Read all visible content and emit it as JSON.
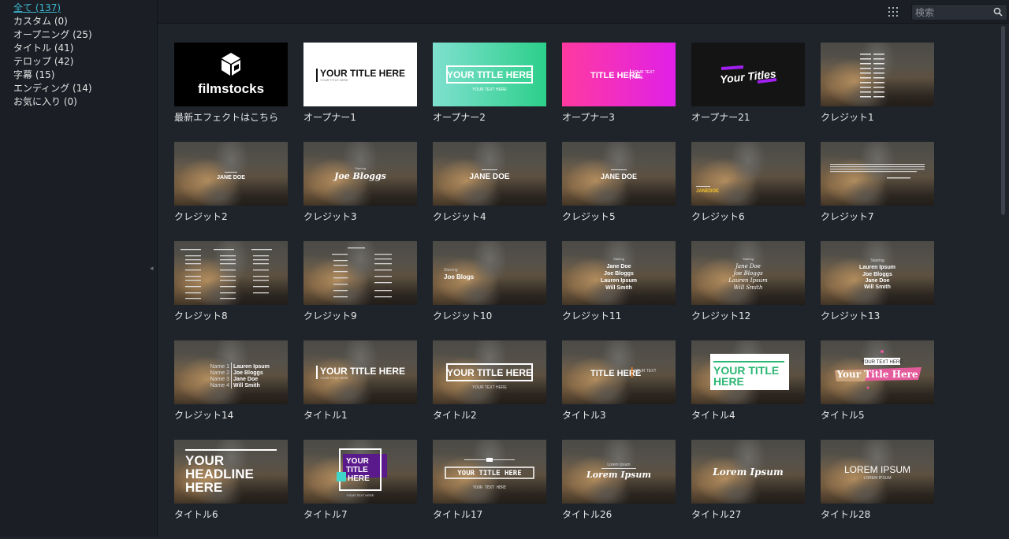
{
  "sidebar": {
    "categories": [
      {
        "label": "全て (137)"
      },
      {
        "label": "カスタム (0)"
      },
      {
        "label": "オープニング (25)"
      },
      {
        "label": "タイトル (41)"
      },
      {
        "label": "テロップ (42)"
      },
      {
        "label": "字幕 (15)"
      },
      {
        "label": "エンディング (14)"
      },
      {
        "label": "お気に入り (0)"
      }
    ],
    "collapse_glyph": "◂"
  },
  "toolbar": {
    "search_placeholder": "検索"
  },
  "colors": {
    "accent": "#3bb6cf",
    "background": "#1f242b",
    "sidebar": "#1b1f25"
  },
  "cards": [
    {
      "label": "最新エフェクトはこちら",
      "texts": [
        "filmstocks"
      ]
    },
    {
      "label": "オープナー1",
      "texts": [
        "YOUR TITLE HERE",
        "YOUR TITLE HERE"
      ]
    },
    {
      "label": "オープナー2",
      "texts": [
        "YOUR TITLE HERE",
        "YOUR TEXT HERE"
      ]
    },
    {
      "label": "オープナー3",
      "texts": [
        "TITLE HERE",
        "YOUR TEXT",
        "HERE"
      ]
    },
    {
      "label": "オープナー21",
      "texts": [
        "Your Titles"
      ]
    },
    {
      "label": "クレジット1",
      "texts": []
    },
    {
      "label": "クレジット2",
      "texts": [
        "JANE DOE"
      ]
    },
    {
      "label": "クレジット3",
      "texts": [
        "Starring",
        "Joe Bloggs"
      ]
    },
    {
      "label": "クレジット4",
      "texts": [
        "JANE DOE"
      ]
    },
    {
      "label": "クレジット5",
      "texts": [
        "JANE DOE"
      ]
    },
    {
      "label": "クレジット6",
      "texts": [
        "JANEDOE"
      ]
    },
    {
      "label": "クレジット7",
      "texts": []
    },
    {
      "label": "クレジット8",
      "texts": []
    },
    {
      "label": "クレジット9",
      "texts": []
    },
    {
      "label": "クレジット10",
      "texts": [
        "Starring",
        "Joe Blogs"
      ]
    },
    {
      "label": "クレジット11",
      "texts": [
        "Starring",
        "Jane Doe",
        "Joe Bloggs",
        "Lauren Ipsum",
        "Will Smith"
      ]
    },
    {
      "label": "クレジット12",
      "texts": [
        "Starring",
        "Jane Doe",
        "Joe Bloggs",
        "Lauren Ipsum",
        "Will Smith"
      ]
    },
    {
      "label": "クレジット13",
      "texts": [
        "Starring",
        "Lauren Ipsum",
        "Joe Bloggs",
        "Jane Doe",
        "Will Smith"
      ]
    },
    {
      "label": "クレジット14",
      "texts": [
        "Name 1",
        "Name 2",
        "Name 3",
        "Name 4",
        "Lauren Ipsum",
        "Joe Bloggs",
        "Jane Doe",
        "Will Smith"
      ]
    },
    {
      "label": "タイトル1",
      "texts": [
        "YOUR TITLE HERE",
        "YOUR TITLE HERE"
      ]
    },
    {
      "label": "タイトル2",
      "texts": [
        "YOUR TITLE HERE",
        "YOUR TEXT HERE"
      ]
    },
    {
      "label": "タイトル3",
      "texts": [
        "TITLE HERE",
        "YOUR TEXT"
      ]
    },
    {
      "label": "タイトル4",
      "texts": [
        "YOUR TITLE",
        "HERE"
      ]
    },
    {
      "label": "タイトル5",
      "texts": [
        "YOUR TEXT HERE",
        "Your Title Here"
      ]
    },
    {
      "label": "タイトル6",
      "texts": [
        "YOUR",
        "HEADLINE",
        "HERE"
      ]
    },
    {
      "label": "タイトル7",
      "texts": [
        "YOUR",
        "TITLE",
        "HERE",
        "YOUR TEXT HERE"
      ]
    },
    {
      "label": "タイトル17",
      "texts": [
        "YOUR TITLE HERE",
        "YOUR TEXT HERE"
      ]
    },
    {
      "label": "タイトル26",
      "texts": [
        "Lorem Ipsum",
        "Lorem Ipsum"
      ]
    },
    {
      "label": "タイトル27",
      "texts": [
        "Lorem Ipsum"
      ]
    },
    {
      "label": "タイトル28",
      "texts": [
        "LOREM IPSUM",
        "LOREM IPSUM"
      ]
    }
  ]
}
